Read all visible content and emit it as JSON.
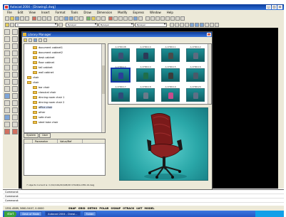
{
  "app": {
    "title": "Autocad 2004 - [Drawing1.dwg]",
    "window_buttons": [
      "_",
      "□",
      "x"
    ]
  },
  "menubar": {
    "items": [
      "File",
      "Edit",
      "View",
      "Insert",
      "Format",
      "Tools",
      "Draw",
      "Dimension",
      "Modify",
      "Express",
      "Window",
      "Help"
    ]
  },
  "toolbar2": {
    "layer_combo": "0",
    "linetype_combo": "ByLayer",
    "lineweight_combo": "ByLayer",
    "color_combo": "ByLayer"
  },
  "library": {
    "title": "Library Manager",
    "close_label": "x",
    "tree": [
      {
        "label": "document cabinet1",
        "indent": 3,
        "selected": false
      },
      {
        "label": "document cabinet2",
        "indent": 3,
        "selected": false
      },
      {
        "label": "desk cabinet",
        "indent": 3,
        "selected": false
      },
      {
        "label": "floor cabinet",
        "indent": 3,
        "selected": false
      },
      {
        "label": "tall cabinet",
        "indent": 3,
        "selected": false
      },
      {
        "label": "wall cabinet",
        "indent": 3,
        "selected": false
      },
      {
        "label": "chair",
        "indent": 2,
        "selected": false
      },
      {
        "label": "chair",
        "indent": 2,
        "selected": false
      },
      {
        "label": "bar chair",
        "indent": 3,
        "selected": false
      },
      {
        "label": "classical chair",
        "indent": 3,
        "selected": false
      },
      {
        "label": "dinning room chair 1",
        "indent": 3,
        "selected": false
      },
      {
        "label": "dinning room chair 2",
        "indent": 3,
        "selected": false
      },
      {
        "label": "office chair",
        "indent": 3,
        "selected": true
      },
      {
        "label": "other",
        "indent": 3,
        "selected": false
      },
      {
        "label": "sofa chair",
        "indent": 3,
        "selected": false
      },
      {
        "label": "steel tube chair",
        "indent": 3,
        "selected": false
      }
    ],
    "tabs": [
      "System",
      "User"
    ],
    "prop_headers": [
      "",
      "Parameter",
      "Value/Ref"
    ],
    "thumbnails": [
      {
        "label": "A-CHR108",
        "chair": "#3d4f73",
        "selected": false
      },
      {
        "label": "A-CHR110",
        "chair": "#2c3a58",
        "selected": false
      },
      {
        "label": "A-CHR111",
        "chair": "#4a4a4a",
        "selected": false
      },
      {
        "label": "A-CHR112",
        "chair": "#5d6b80",
        "selected": false
      },
      {
        "label": "A-CHR113",
        "chair": "#2a3f9a",
        "selected": true
      },
      {
        "label": "A-CHR114",
        "chair": "#1f6f4a",
        "selected": false
      },
      {
        "label": "A-CHR115",
        "chair": "#3b3b3b",
        "selected": false
      },
      {
        "label": "A-CHR116",
        "chair": "#4a5a6a",
        "selected": false
      },
      {
        "label": "A-CHR117",
        "chair": "#2f4a78",
        "selected": false
      },
      {
        "label": "A-CHR118",
        "chair": "#6a7a8a",
        "selected": false
      },
      {
        "label": "A-CHR119",
        "chair": "#c64b8c",
        "selected": false
      },
      {
        "label": "A-CHR120",
        "chair": "#5e6f86",
        "selected": false
      }
    ],
    "status": "7 objects  Current is: C:/lib/mlib/2D/LIB/2D CHAIR/A-CHR-19.dwg"
  },
  "command": {
    "lines": [
      "Command:",
      "Command:",
      "Command:"
    ]
  },
  "statusbar": {
    "coords": "1351.4589, 5661.5407, 0.0000",
    "modes": [
      "SNAP",
      "GRID",
      "ORTHO",
      "POLAR",
      "OSNAP",
      "OTRACK",
      "LWT",
      "MODEL"
    ]
  },
  "taskbar": {
    "start": "start",
    "tasks": [
      {
        "label": "Desk of Made",
        "active": false
      },
      {
        "label": "Autocad 2004 - Drawi...",
        "active": true
      },
      {
        "label": "Folder",
        "active": false
      },
      {
        "label": "",
        "active": false
      }
    ]
  }
}
